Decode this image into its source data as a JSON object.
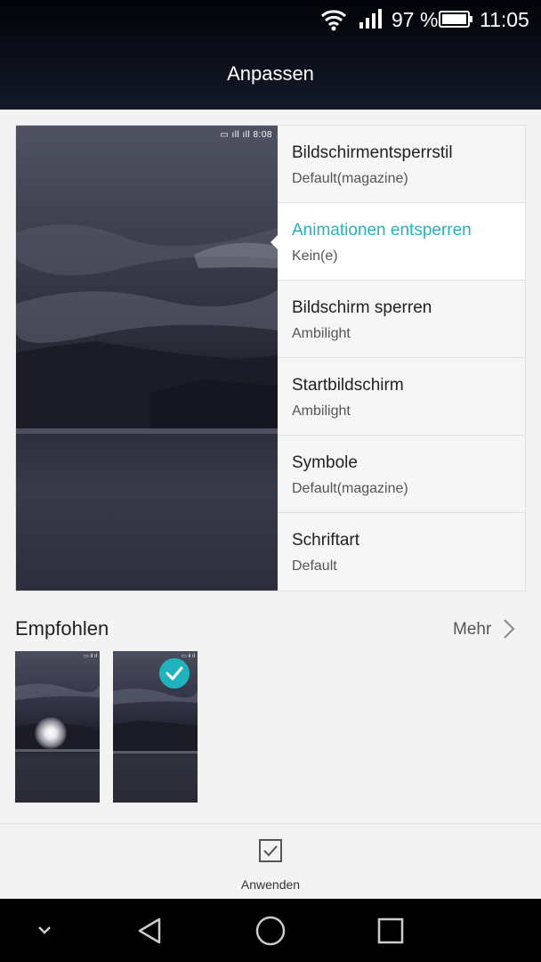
{
  "status_bar": {
    "battery_percent": "97 %",
    "time": "11:05"
  },
  "header": {
    "title": "Anpassen"
  },
  "preview": {
    "status_time": "8:08"
  },
  "menu": {
    "items": [
      {
        "title": "Bildschirmentsperrstil",
        "subtitle": "Default(magazine)"
      },
      {
        "title": "Animationen entsperren",
        "subtitle": "Kein(e)"
      },
      {
        "title": "Bildschirm sperren",
        "subtitle": "Ambilight"
      },
      {
        "title": "Startbildschirm",
        "subtitle": "Ambilight"
      },
      {
        "title": "Symbole",
        "subtitle": "Default(magazine)"
      },
      {
        "title": "Schriftart",
        "subtitle": "Default"
      }
    ],
    "active_index": 1
  },
  "recommended": {
    "title": "Empfohlen",
    "more_label": "Mehr"
  },
  "action": {
    "apply_label": "Anwenden"
  },
  "colors": {
    "accent": "#21b3bd"
  }
}
